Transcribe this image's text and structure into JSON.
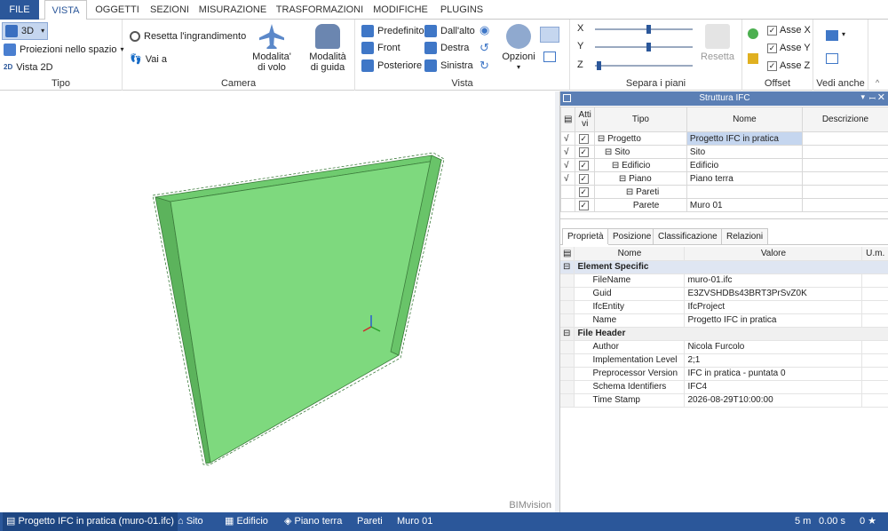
{
  "menu": {
    "tabs": [
      "FILE",
      "VISTA",
      "OGGETTI",
      "SEZIONI",
      "MISURAZIONE",
      "TRASFORMAZIONI",
      "MODIFICHE",
      "PLUGINS"
    ]
  },
  "ribbon": {
    "tipo": {
      "btn_3d": "3D",
      "proiezioni": "Proiezioni nello spazio",
      "vista2d": "Vista 2D",
      "vista2d_icon": "2D",
      "label": "Tipo"
    },
    "camera": {
      "resetta": "Resetta l'ingrandimento",
      "vai": "Vai a",
      "modalita_volo": "Modalita'\ndi volo",
      "modalita_guida": "Modalità\ndi guida",
      "label": "Camera"
    },
    "vista": {
      "predefinito": "Predefinito",
      "dallalto": "Dall'alto",
      "front": "Front",
      "destra": "Destra",
      "posteriore": "Posteriore",
      "sinistra": "Sinistra",
      "opzioni": "Opzioni",
      "label": "Vista"
    },
    "separa": {
      "x": "X",
      "y": "Y",
      "z": "Z",
      "x_level": 0.55,
      "y_level": 0.55,
      "z_level": 0.02,
      "resetta": "Resetta",
      "label": "Separa i piani"
    },
    "offset": {
      "asse_x": "Asse X",
      "asse_y": "Asse Y",
      "asse_z": "Asse Z",
      "label": "Offset"
    },
    "vedi": {
      "label": "Vedi anche"
    }
  },
  "viewport": {
    "watermark": "BIMvision",
    "wall_color": "#7ed97e"
  },
  "tree": {
    "title": "Struttura IFC",
    "cols": {
      "attivi": "Atti\nvi",
      "tipo": "Tipo",
      "nome": "Nome",
      "descrizione": "Descrizione"
    },
    "rows": [
      {
        "tipo": "Progetto",
        "nome": "Progetto IFC in pratica"
      },
      {
        "tipo": "Sito",
        "nome": "Sito"
      },
      {
        "tipo": "Edificio",
        "nome": "Edificio"
      },
      {
        "tipo": "Piano",
        "nome": "Piano terra"
      },
      {
        "tipo": "Pareti",
        "nome": ""
      },
      {
        "tipo": "Parete",
        "nome": "Muro 01"
      }
    ]
  },
  "props": {
    "tabs": [
      "Proprietà",
      "Posizione",
      "Classificazione",
      "Relazioni"
    ],
    "cols": {
      "nome": "Nome",
      "valore": "Valore",
      "um": "U.m."
    },
    "group1": "Element Specific",
    "rows1": [
      {
        "k": "FileName",
        "v": "muro-01.ifc"
      },
      {
        "k": "Guid",
        "v": "E3ZVSHDBs43BRT3PrSvZ0K"
      },
      {
        "k": "IfcEntity",
        "v": "IfcProject"
      },
      {
        "k": "Name",
        "v": "Progetto IFC in pratica"
      }
    ],
    "group2": "File Header",
    "rows2": [
      {
        "k": "Author",
        "v": "Nicola Furcolo"
      },
      {
        "k": "Implementation Level",
        "v": "2;1"
      },
      {
        "k": "Preprocessor Version",
        "v": "IFC in pratica - puntata 0"
      },
      {
        "k": "Schema Identifiers",
        "v": "IFC4"
      },
      {
        "k": "Time Stamp",
        "v": "2026-08-29T10:00:00"
      }
    ]
  },
  "status": {
    "project": "Progetto IFC in pratica (muro-01.ifc)",
    "sito": "Sito",
    "edificio": "Edificio",
    "piano": "Piano terra",
    "pareti": "Pareti",
    "muro": "Muro 01",
    "dist": "5 m",
    "time": "0.00 s",
    "stars": "0 ★"
  }
}
